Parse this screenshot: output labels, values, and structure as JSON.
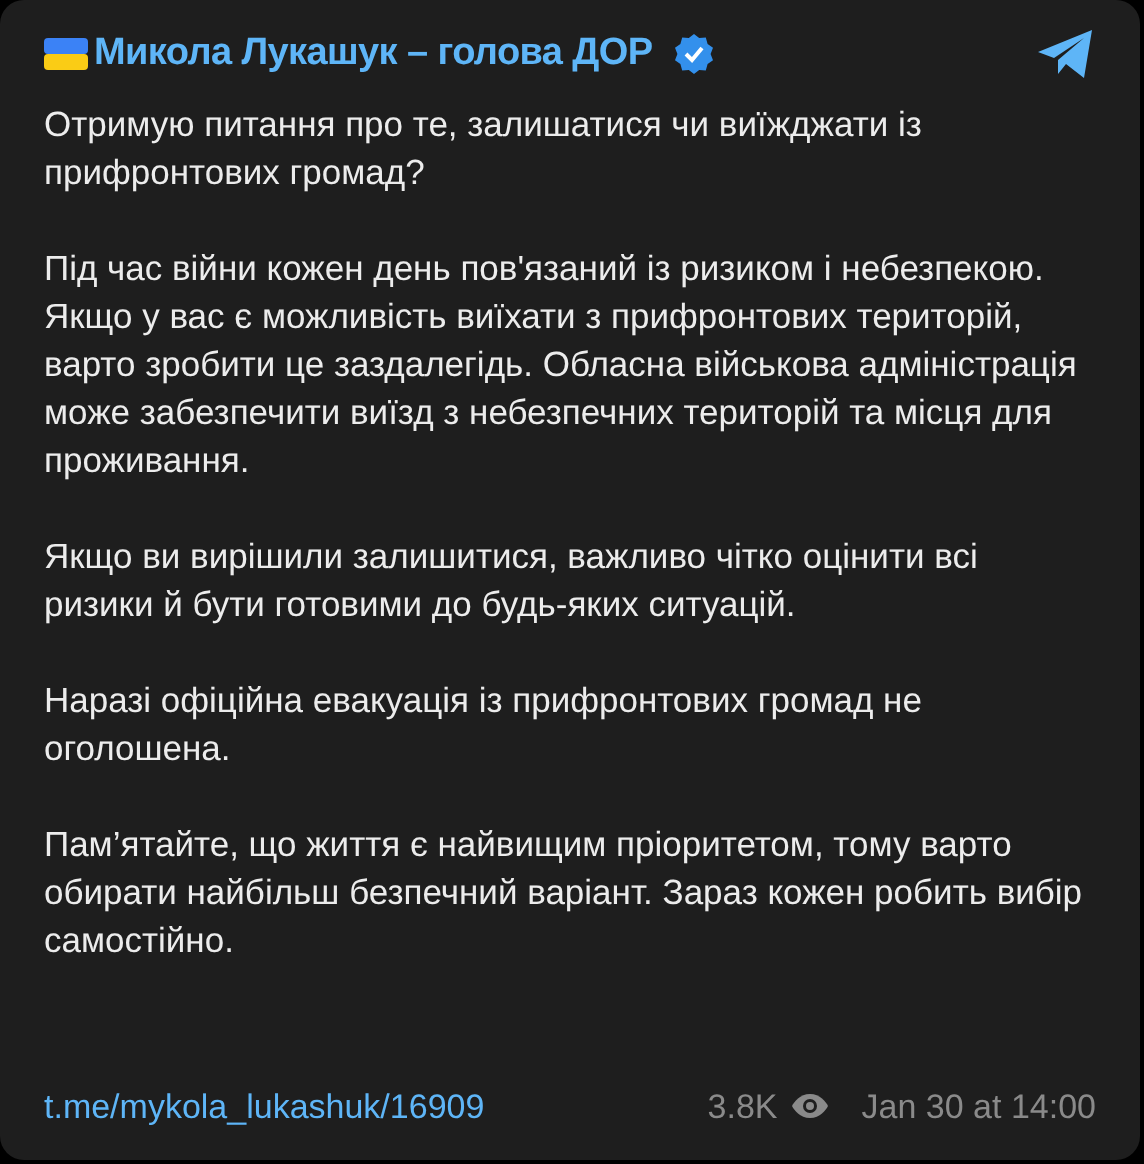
{
  "channel": {
    "name": "Микола Лукашук – голова ДОР",
    "verified": true
  },
  "paragraphs": [
    "Отримую питання про те, залишатися чи виїжджати із прифронтових громад?",
    "Під час війни кожен день пов'язаний із ризиком і небезпекою. Якщо у вас є можливість виїхати з прифронтових територій, варто зробити це заздалегідь. Обласна військова адміністрація може забезпечити виїзд з небезпечних територій та місця для проживання.",
    "Якщо ви вирішили залишитися, важливо чітко оцінити всі ризики й бути готовими до будь-яких ситуацій.",
    "Наразі офіційна евакуація із прифронтових громад не оголошена.",
    "Пам’ятайте, що життя є найвищим пріоритетом, тому варто обирати найбільш безпечний варіант. Зараз кожен робить вибір самостійно."
  ],
  "footer": {
    "link": "t.me/mykola_lukashuk/16909",
    "views": "3.8K",
    "date": "Jan 30 at 14:00"
  }
}
